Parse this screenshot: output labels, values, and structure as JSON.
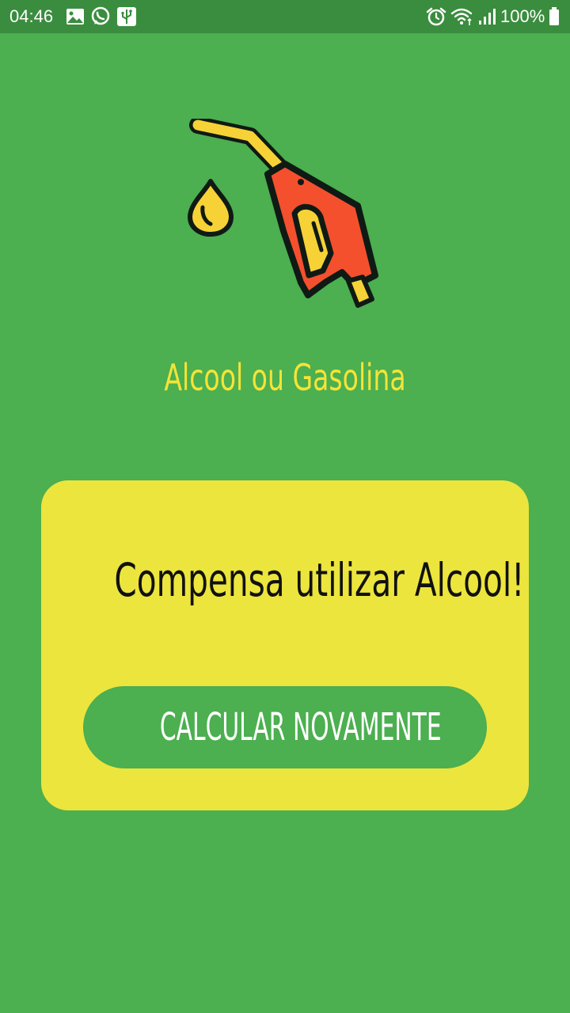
{
  "status_bar": {
    "time": "04:46",
    "battery_percent": "100%",
    "left_icons": [
      "image-icon",
      "whatsapp-icon",
      "usb-icon"
    ],
    "right_icons": [
      "alarm-icon",
      "wifi-icon",
      "signal-icon",
      "battery-icon"
    ]
  },
  "hero": {
    "icon": "fuel-pump-nozzle-icon"
  },
  "app": {
    "title": "Alcool ou Gasolina"
  },
  "result": {
    "message": "Compensa utilizar Alcool!",
    "button_label": "CALCULAR NOVAMENTE"
  },
  "colors": {
    "background": "#4caf50",
    "status_bar": "#3a8d3e",
    "title": "#f4e437",
    "card": "#ece53d",
    "button": "#4caf50",
    "nozzle": "#f4502e",
    "drop": "#f6d236"
  }
}
